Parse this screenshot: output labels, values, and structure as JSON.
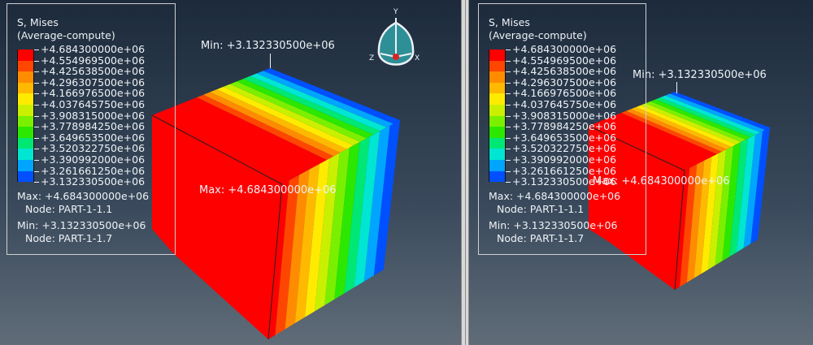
{
  "viewports": [
    {
      "legend": {
        "title1": "S, Mises",
        "title2": "(Average-compute)",
        "levels": [
          "+4.684300000e+06",
          "+4.554969500e+06",
          "+4.425638500e+06",
          "+4.296307500e+06",
          "+4.166976500e+06",
          "+4.037645750e+06",
          "+3.908315000e+06",
          "+3.778984250e+06",
          "+3.649653500e+06",
          "+3.520322750e+06",
          "+3.390992000e+06",
          "+3.261661250e+06",
          "+3.132330500e+06"
        ],
        "max_label": "Max: +4.684300000e+06",
        "max_node": "Node: PART-1-1.1",
        "min_label": "Min: +3.132330500e+06",
        "min_node": "Node: PART-1-1.7"
      },
      "min_annotation": "Min: +3.132330500e+06",
      "max_annotation": "Max: +4.684300000e+06",
      "triad": {
        "y": "Y",
        "z": "Z",
        "x": "X"
      }
    },
    {
      "legend": {
        "title1": "S, Mises",
        "title2": "(Average-compute)",
        "levels": [
          "+4.684300000e+06",
          "+4.554969500e+06",
          "+4.425638500e+06",
          "+4.296307500e+06",
          "+4.166976500e+06",
          "+4.037645750e+06",
          "+3.908315000e+06",
          "+3.778984250e+06",
          "+3.649653500e+06",
          "+3.520322750e+06",
          "+3.390992000e+06",
          "+3.261661250e+06",
          "+3.132330500e+06"
        ],
        "max_label": "Max: +4.684300000e+06",
        "max_node": "Node: PART-1-1.1",
        "min_label": "Min: +3.132330500e+06",
        "min_node": "Node: PART-1-1.7"
      },
      "min_annotation": "Min: +3.132330500e+06",
      "max_annotation": "Max: +4.684300000e+06"
    }
  ],
  "colors": {
    "bands": [
      "#ff0000",
      "#ff4600",
      "#ff8c00",
      "#ffb900",
      "#ffeb00",
      "#c9f000",
      "#7af000",
      "#2ce800",
      "#00e873",
      "#00e6d2",
      "#00a5ff",
      "#0050ff",
      "#0000f0"
    ]
  }
}
